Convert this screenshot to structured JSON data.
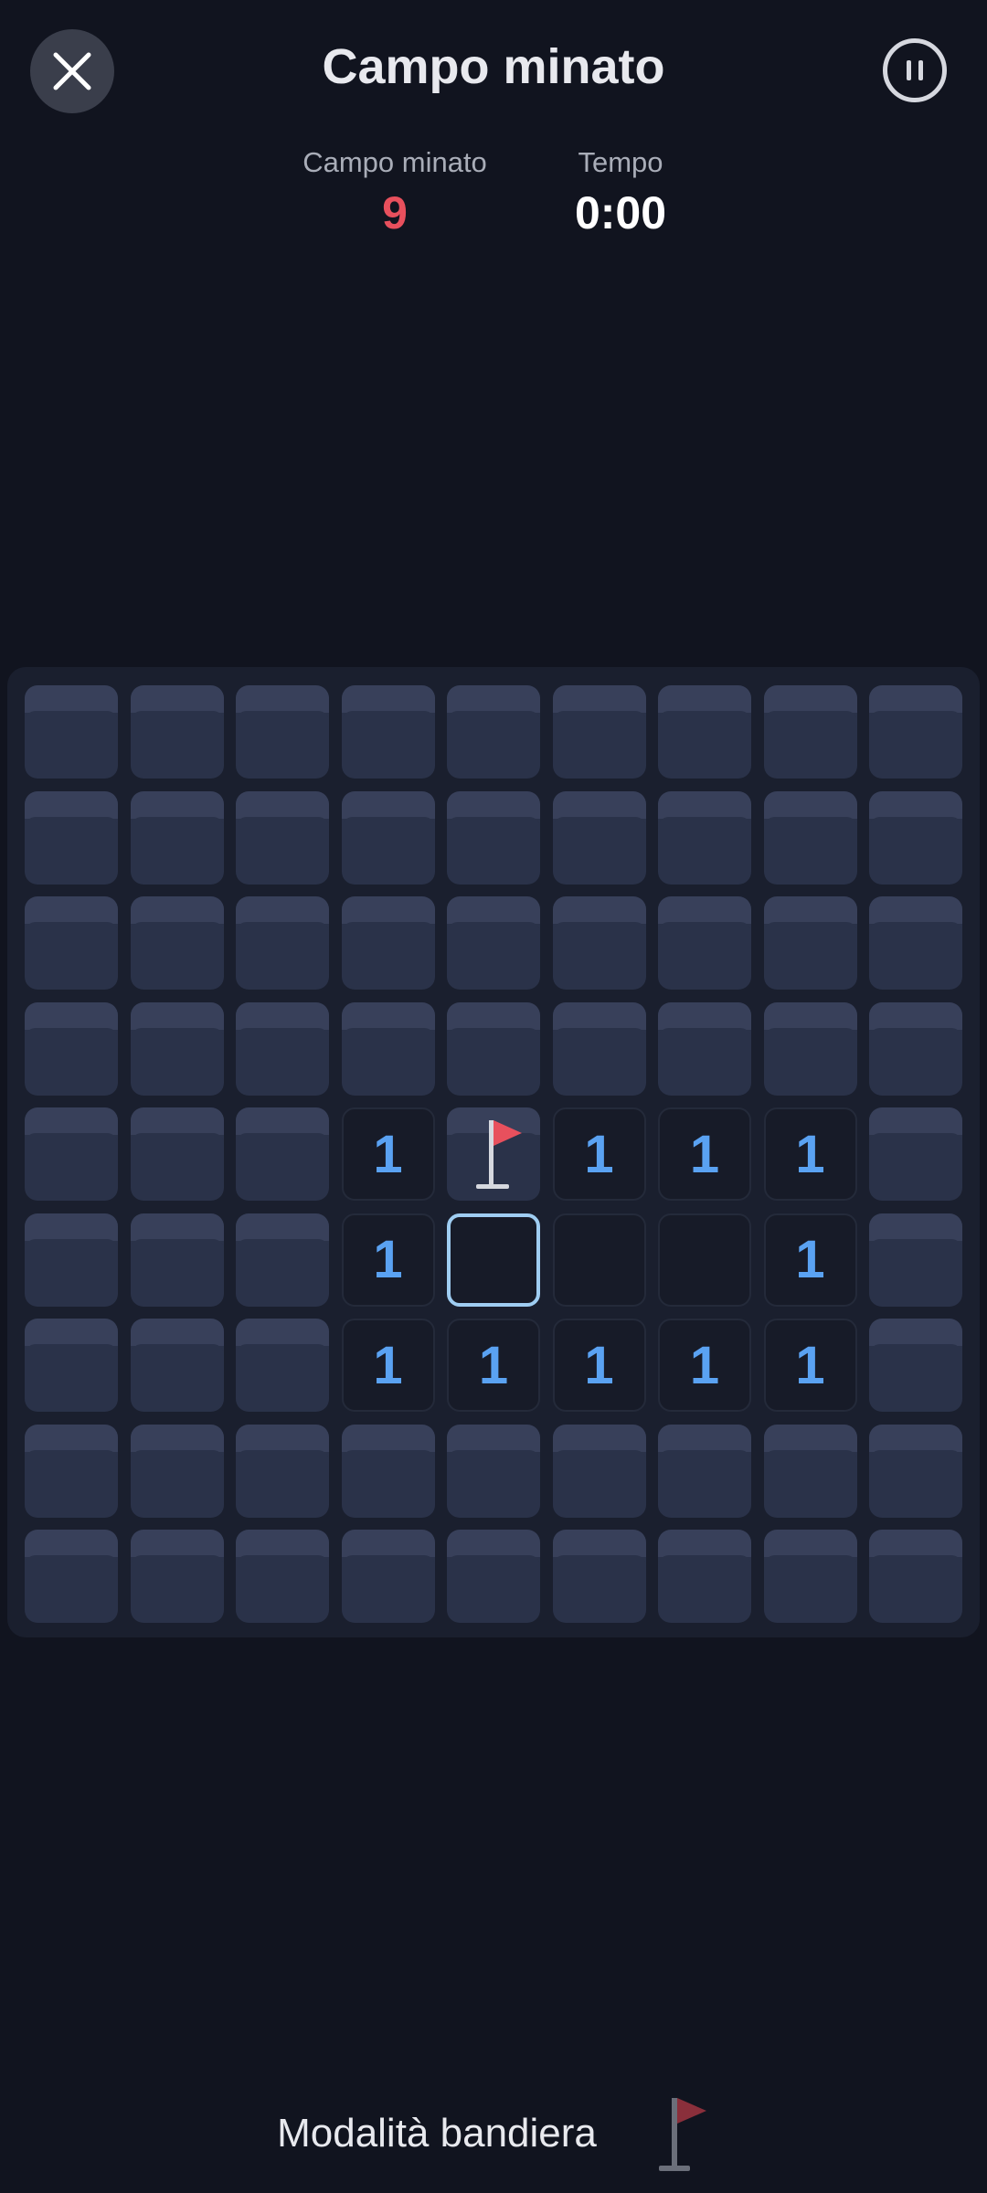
{
  "header": {
    "title": "Campo minato",
    "close_icon": "close-icon",
    "pause_icon": "pause-icon"
  },
  "stats": {
    "mines_label": "Campo minato",
    "mines_value": "9",
    "time_label": "Tempo",
    "time_value": "0:00"
  },
  "board": {
    "rows": 9,
    "cols": 9,
    "legend": "H = hidden, F = flag, S = selected, 0 = revealed empty, digit = revealed number",
    "cells": [
      [
        "H",
        "H",
        "H",
        "H",
        "H",
        "H",
        "H",
        "H",
        "H"
      ],
      [
        "H",
        "H",
        "H",
        "H",
        "H",
        "H",
        "H",
        "H",
        "H"
      ],
      [
        "H",
        "H",
        "H",
        "H",
        "H",
        "H",
        "H",
        "H",
        "H"
      ],
      [
        "H",
        "H",
        "H",
        "H",
        "H",
        "H",
        "H",
        "H",
        "H"
      ],
      [
        "H",
        "H",
        "H",
        "1",
        "F",
        "1",
        "1",
        "1",
        "H"
      ],
      [
        "H",
        "H",
        "H",
        "1",
        "S",
        "0",
        "0",
        "1",
        "H"
      ],
      [
        "H",
        "H",
        "H",
        "1",
        "1",
        "1",
        "1",
        "1",
        "H"
      ],
      [
        "H",
        "H",
        "H",
        "H",
        "H",
        "H",
        "H",
        "H",
        "H"
      ],
      [
        "H",
        "H",
        "H",
        "H",
        "H",
        "H",
        "H",
        "H",
        "H"
      ]
    ]
  },
  "footer": {
    "flag_mode_label": "Modalità bandiera",
    "flag_icon": "flag-icon"
  },
  "colors": {
    "background": "#11141f",
    "board": "#1a1f2e",
    "hidden_tile": "#2a3249",
    "number": "#5aa2f2",
    "mine_count": "#e8505d",
    "flag": "#e8505d",
    "selection": "#9fcdf2"
  }
}
